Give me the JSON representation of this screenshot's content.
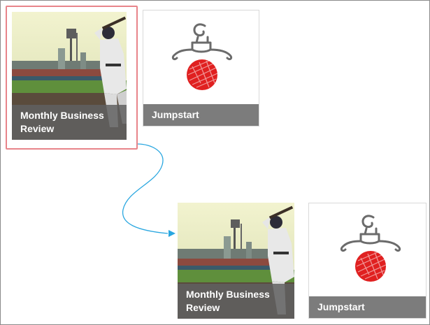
{
  "tiles": [
    {
      "title": "Monthly Business Review",
      "image": "baseball-player-photo"
    },
    {
      "title": "Jumpstart",
      "image": "jumpstart-logo"
    },
    {
      "title": "Monthly Business Review",
      "image": "baseball-player-photo"
    },
    {
      "title": "Jumpstart",
      "image": "jumpstart-logo"
    }
  ],
  "colors": {
    "highlight_border": "#e8848a",
    "connector": "#2aa7e0",
    "caption_bg": "#7c7c7c",
    "logo_ball": "#e02020"
  }
}
